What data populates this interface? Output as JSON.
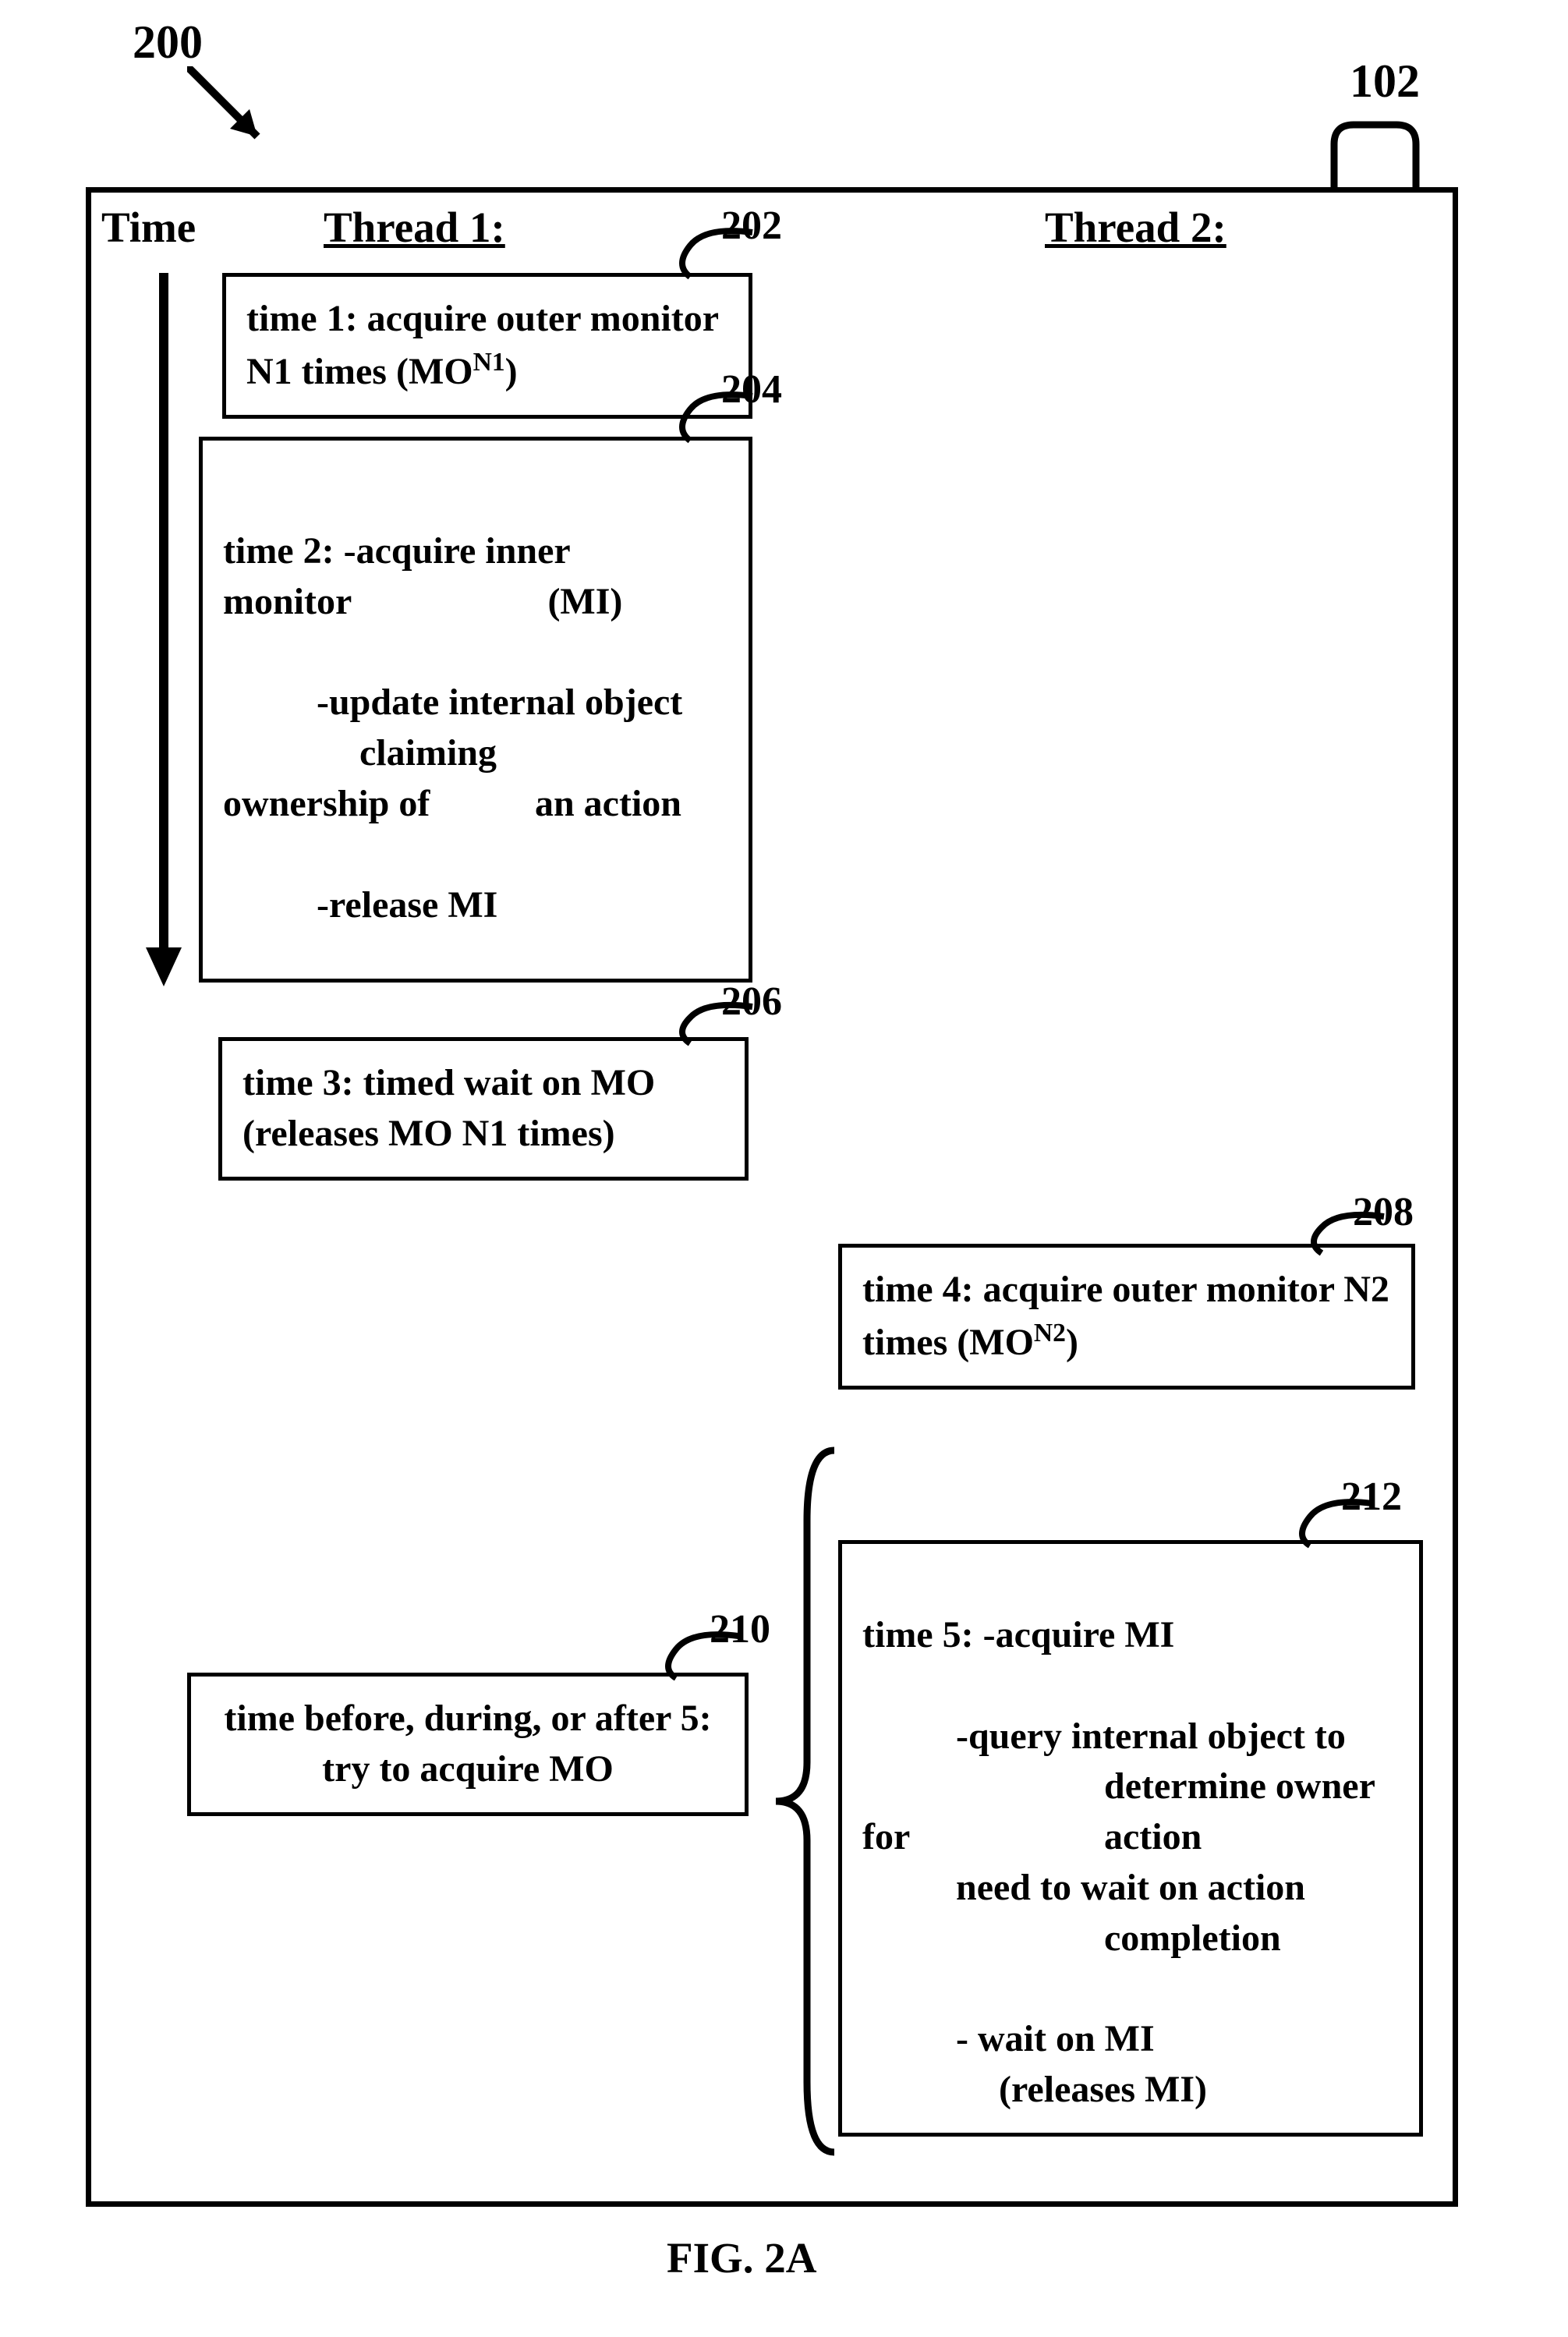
{
  "figureNumber": "200",
  "outerBoxLabel": "102",
  "timeLabel": "Time",
  "thread1": "Thread 1:",
  "thread2": "Thread 2:",
  "boxes": {
    "b202": {
      "label": "202",
      "line1": "time 1:  acquire outer monitor N1 times (MO",
      "sup": "N1",
      "line1end": ")"
    },
    "b204": {
      "label": "204",
      "line1": "time 2:  -acquire inner",
      "line2": "monitor                     (MI)",
      "line3": "-update internal object",
      "line4": "claiming",
      "line5a": "ownership of",
      "line5b": "an action",
      "line6": "-release MI"
    },
    "b206": {
      "label": "206",
      "line1": "time 3:  timed wait on MO",
      "line2": "(releases MO N1 times)"
    },
    "b208": {
      "label": "208",
      "line1": "time 4:  acquire outer monitor N2 times (MO",
      "sup": "N2",
      "line1end": ")"
    },
    "b210": {
      "label": "210",
      "line1": "time before, during, or after 5:",
      "line2": "try to acquire MO"
    },
    "b212": {
      "label": "212",
      "line1": "time 5:  -acquire MI",
      "line2": "-query internal object to",
      "line3": "determine owner",
      "line4a": "for",
      "line4b": "action",
      "line5": "need to wait on action",
      "line6": "completion",
      "line7": "- wait on MI",
      "line8": "(releases MI)"
    }
  },
  "caption": "FIG. 2A"
}
